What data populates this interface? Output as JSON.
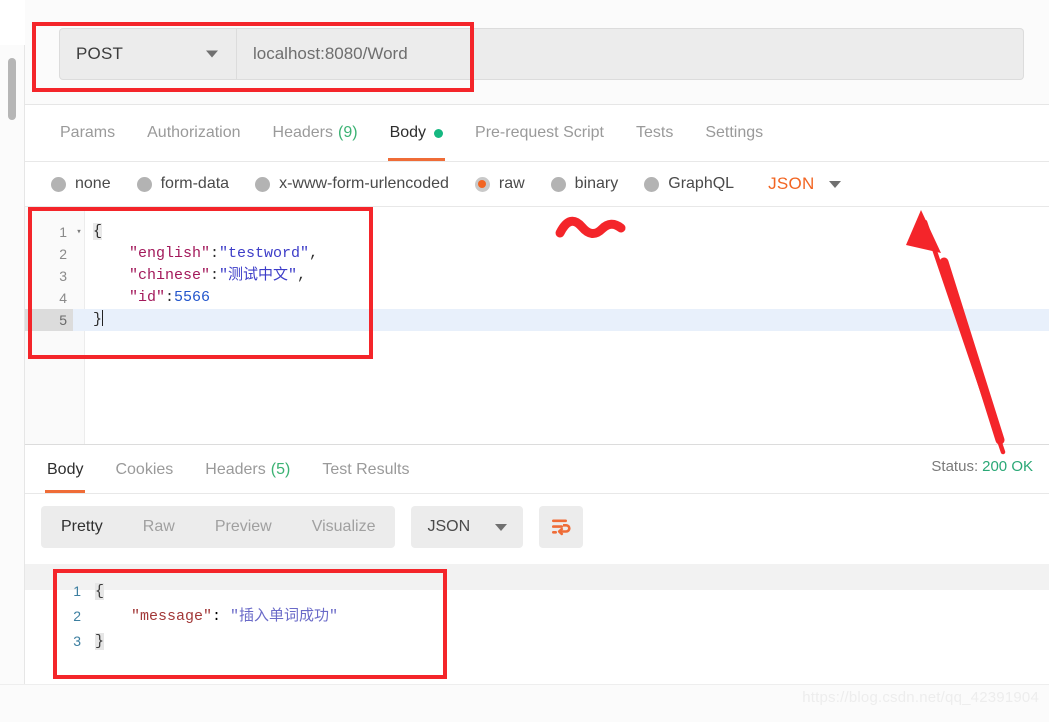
{
  "app": "Postman",
  "request": {
    "method": "POST",
    "method_caret": "chevron-down",
    "url": "localhost:8080/Word",
    "tabs": [
      {
        "label": "Params",
        "active": false
      },
      {
        "label": "Authorization",
        "active": false
      },
      {
        "label": "Headers",
        "count": "(9)",
        "active": false
      },
      {
        "label": "Body",
        "active": true,
        "dot": true
      },
      {
        "label": "Pre-request Script",
        "active": false
      },
      {
        "label": "Tests",
        "active": false
      },
      {
        "label": "Settings",
        "active": false
      }
    ],
    "body_types": [
      {
        "label": "none",
        "selected": false
      },
      {
        "label": "form-data",
        "selected": false
      },
      {
        "label": "x-www-form-urlencoded",
        "selected": false
      },
      {
        "label": "raw",
        "selected": true
      },
      {
        "label": "binary",
        "selected": false
      },
      {
        "label": "GraphQL",
        "selected": false
      }
    ],
    "raw_format": "JSON",
    "body_lines": [
      {
        "num": "1",
        "fold": "▾",
        "brace": "{",
        "rest": ""
      },
      {
        "num": "2",
        "key": "\"english\"",
        "colon": ":",
        "value": "\"testword\"",
        "comma": ","
      },
      {
        "num": "3",
        "key": "\"chinese\"",
        "colon": ":",
        "value": "\"测试中文\"",
        "comma": ","
      },
      {
        "num": "4",
        "key": "\"id\"",
        "colon": ":",
        "number": "5566",
        "comma": ""
      },
      {
        "num": "5",
        "brace": "}",
        "current": true
      }
    ]
  },
  "response": {
    "tabs": [
      {
        "label": "Body",
        "active": true
      },
      {
        "label": "Cookies",
        "active": false
      },
      {
        "label": "Headers",
        "count": "(5)",
        "active": false
      },
      {
        "label": "Test Results",
        "active": false
      }
    ],
    "status_label": "Status:",
    "status_value": "200 OK",
    "view_modes": [
      {
        "label": "Pretty",
        "active": true
      },
      {
        "label": "Raw",
        "active": false
      },
      {
        "label": "Preview",
        "active": false
      },
      {
        "label": "Visualize",
        "active": false
      }
    ],
    "format": "JSON",
    "wrap_icon": "word-wrap-icon",
    "body_lines": [
      {
        "num": "1",
        "brace": "{"
      },
      {
        "num": "2",
        "key": "\"message\"",
        "colon": ": ",
        "value": "\"插入单词成功\""
      },
      {
        "num": "3",
        "brace": "}"
      }
    ]
  },
  "annotations": {
    "box_color": "#f4252a",
    "arrow_target": "JSON format dropdown",
    "squiggle_target": "raw radio button"
  },
  "watermark": "https://blog.csdn.net/qq_42391904"
}
